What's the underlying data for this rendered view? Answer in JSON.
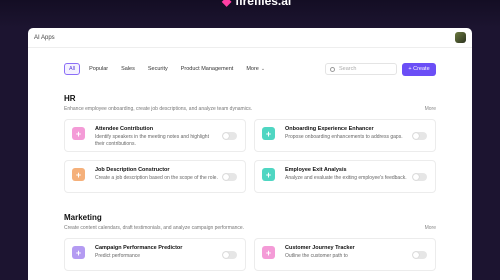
{
  "brand": {
    "name": "firefiles.ai"
  },
  "window": {
    "title": "AI Apps"
  },
  "filters": [
    {
      "label": "All",
      "active": true
    },
    {
      "label": "Popular"
    },
    {
      "label": "Sales"
    },
    {
      "label": "Security"
    },
    {
      "label": "Product Management"
    },
    {
      "label": "More",
      "dropdown": true
    }
  ],
  "search": {
    "placeholder": "Search"
  },
  "create_button": {
    "label": "+ Create"
  },
  "colors": {
    "accent": "#6b4ef6",
    "pink": "#f49bd7",
    "mint": "#4fd6c2",
    "orange": "#f5b07a",
    "purple": "#b49bf2"
  },
  "sections": [
    {
      "title": "HR",
      "description": "Enhance employee onboarding, create job descriptions, and analyze team dynamics.",
      "more": "More",
      "cards": [
        {
          "title": "Attendee Contribution",
          "description": "Identify speakers in the meeting notes and highlight their contributions.",
          "icon": "plus-icon",
          "color": "#f49bd7"
        },
        {
          "title": "Onboarding Experience Enhancer",
          "description": "Propose onboarding enhancements to address gaps.",
          "icon": "plus-icon",
          "color": "#4fd6c2"
        },
        {
          "title": "Job Description Constructor",
          "description": "Create a job description based on the scope of the role.",
          "icon": "plus-icon",
          "color": "#f5b07a"
        },
        {
          "title": "Employee Exit Analysis",
          "description": "Analyze and evaluate the exiting employee's feedback.",
          "icon": "plus-icon",
          "color": "#4fd6c2"
        }
      ]
    },
    {
      "title": "Marketing",
      "description": "Create content calendars, draft testimonials, and analyze campaign performance.",
      "more": "More",
      "cards": [
        {
          "title": "Campaign Performance Predictor",
          "description": "Predict performance",
          "icon": "plus-icon",
          "color": "#b49bf2"
        },
        {
          "title": "Customer Journey Tracker",
          "description": "Outline the customer path to",
          "icon": "plus-icon",
          "color": "#f49bd7"
        }
      ]
    }
  ]
}
